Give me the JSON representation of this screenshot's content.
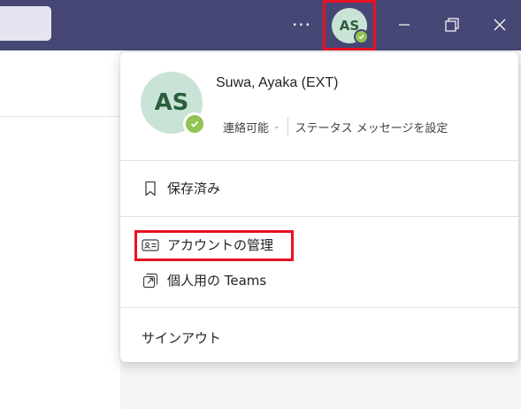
{
  "titlebar": {
    "more_label": "···",
    "avatar_initials": "AS",
    "icons": [
      "more-icon",
      "presence-available-icon",
      "minimize-icon",
      "restore-icon",
      "close-icon"
    ]
  },
  "profile_menu": {
    "initials": "AS",
    "name": "Suwa, Ayaka (EXT)",
    "status": "連絡可能",
    "status_message_label": "ステータス メッセージを設定",
    "items": [
      {
        "label": "保存済み",
        "icon": "bookmark-icon"
      },
      {
        "label": "アカウントの管理",
        "icon": "contact-card-icon"
      },
      {
        "label": "個人用の Teams",
        "icon": "open-external-icon"
      }
    ],
    "sign_out_label": "サインアウト"
  },
  "colors": {
    "titlebar": "#464775",
    "avatar_bg": "#c9e4d6",
    "avatar_text": "#2b5d3d",
    "presence_available": "#92c353",
    "highlight": "#e81123"
  }
}
